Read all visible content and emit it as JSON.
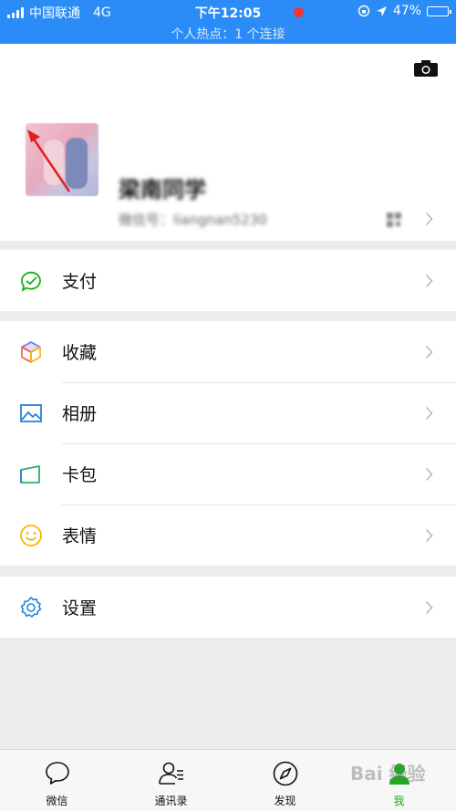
{
  "status_bar": {
    "carrier": "中国联通",
    "network": "4G",
    "time": "下午12:05",
    "battery": "47%",
    "battery_level": 0.47,
    "hotspot": "个人热点：1 个连接"
  },
  "profile": {
    "nickname": "梁南同学",
    "wechat_id": "微信号：liangnan5230"
  },
  "menu": {
    "pay": "支付",
    "favorites": "收藏",
    "album": "相册",
    "cards": "卡包",
    "stickers": "表情",
    "settings": "设置"
  },
  "tabbar": {
    "chats": "微信",
    "contacts": "通讯录",
    "discover": "发现",
    "me": "我",
    "active": "me"
  },
  "watermark": "Bai 经验",
  "colors": {
    "status_bar": "#2b8cf7",
    "accent_green": "#1aad19",
    "badge_red": "#f43530"
  }
}
